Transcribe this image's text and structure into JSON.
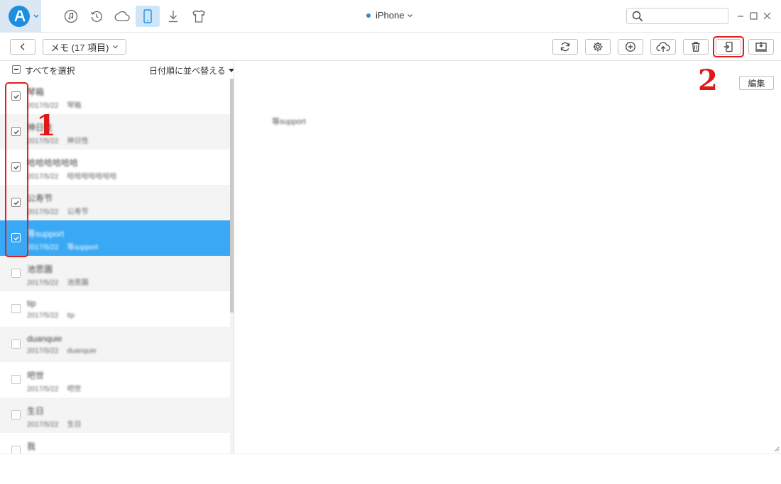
{
  "header": {
    "device_name": "iPhone",
    "search": {
      "value": "",
      "placeholder": ""
    }
  },
  "nav_icons": [
    "music-icon",
    "history-icon",
    "cloud-icon",
    "phone-icon",
    "download-icon",
    "tshirt-icon"
  ],
  "toolbar": {
    "category_label": "メモ (17 項目)",
    "actions": [
      "refresh-icon",
      "settings-icon",
      "add-icon",
      "upload-icon",
      "trash-icon",
      "to-device-icon",
      "to-computer-icon"
    ]
  },
  "list": {
    "select_all_label": "すべてを選択",
    "sort_label": "日付順に並べ替える",
    "rows": [
      {
        "title": "琴箱",
        "date": "2017/5/22",
        "preview": "琴箱",
        "checked": true,
        "selected": false,
        "alt": false
      },
      {
        "title": "神日性",
        "date": "2017/5/22",
        "preview": "神日性",
        "checked": true,
        "selected": false,
        "alt": true
      },
      {
        "title": "哈哈哈哈哈哈",
        "date": "2017/5/22",
        "preview": "哈哈哈哈哈哈哈",
        "checked": true,
        "selected": false,
        "alt": false
      },
      {
        "title": "公寿节",
        "date": "2017/5/22",
        "preview": "公寿节",
        "checked": true,
        "selected": false,
        "alt": true
      },
      {
        "title": "等support",
        "date": "2017/5/22",
        "preview": "等support",
        "checked": true,
        "selected": true,
        "alt": false
      },
      {
        "title": "池思園",
        "date": "2017/5/22",
        "preview": "池思園",
        "checked": false,
        "selected": false,
        "alt": true
      },
      {
        "title": "tip",
        "date": "2017/5/22",
        "preview": "tip",
        "checked": false,
        "selected": false,
        "alt": false
      },
      {
        "title": "duanquie",
        "date": "2017/5/22",
        "preview": "duanquie",
        "checked": false,
        "selected": false,
        "alt": true
      },
      {
        "title": "吧世",
        "date": "2017/5/22",
        "preview": "吧世",
        "checked": false,
        "selected": false,
        "alt": false
      },
      {
        "title": "生日",
        "date": "2017/5/22",
        "preview": "生日",
        "checked": false,
        "selected": false,
        "alt": true
      },
      {
        "title": "我",
        "date": "",
        "preview": "",
        "checked": false,
        "selected": false,
        "alt": false
      }
    ]
  },
  "detail": {
    "edit_label": "編集",
    "content_text": "等support"
  },
  "annotations": {
    "step1": "1",
    "step2": "2"
  },
  "colors": {
    "accent": "#1e8fe0",
    "selected_row": "#39a9f5",
    "annotation_red": "#e01818"
  }
}
